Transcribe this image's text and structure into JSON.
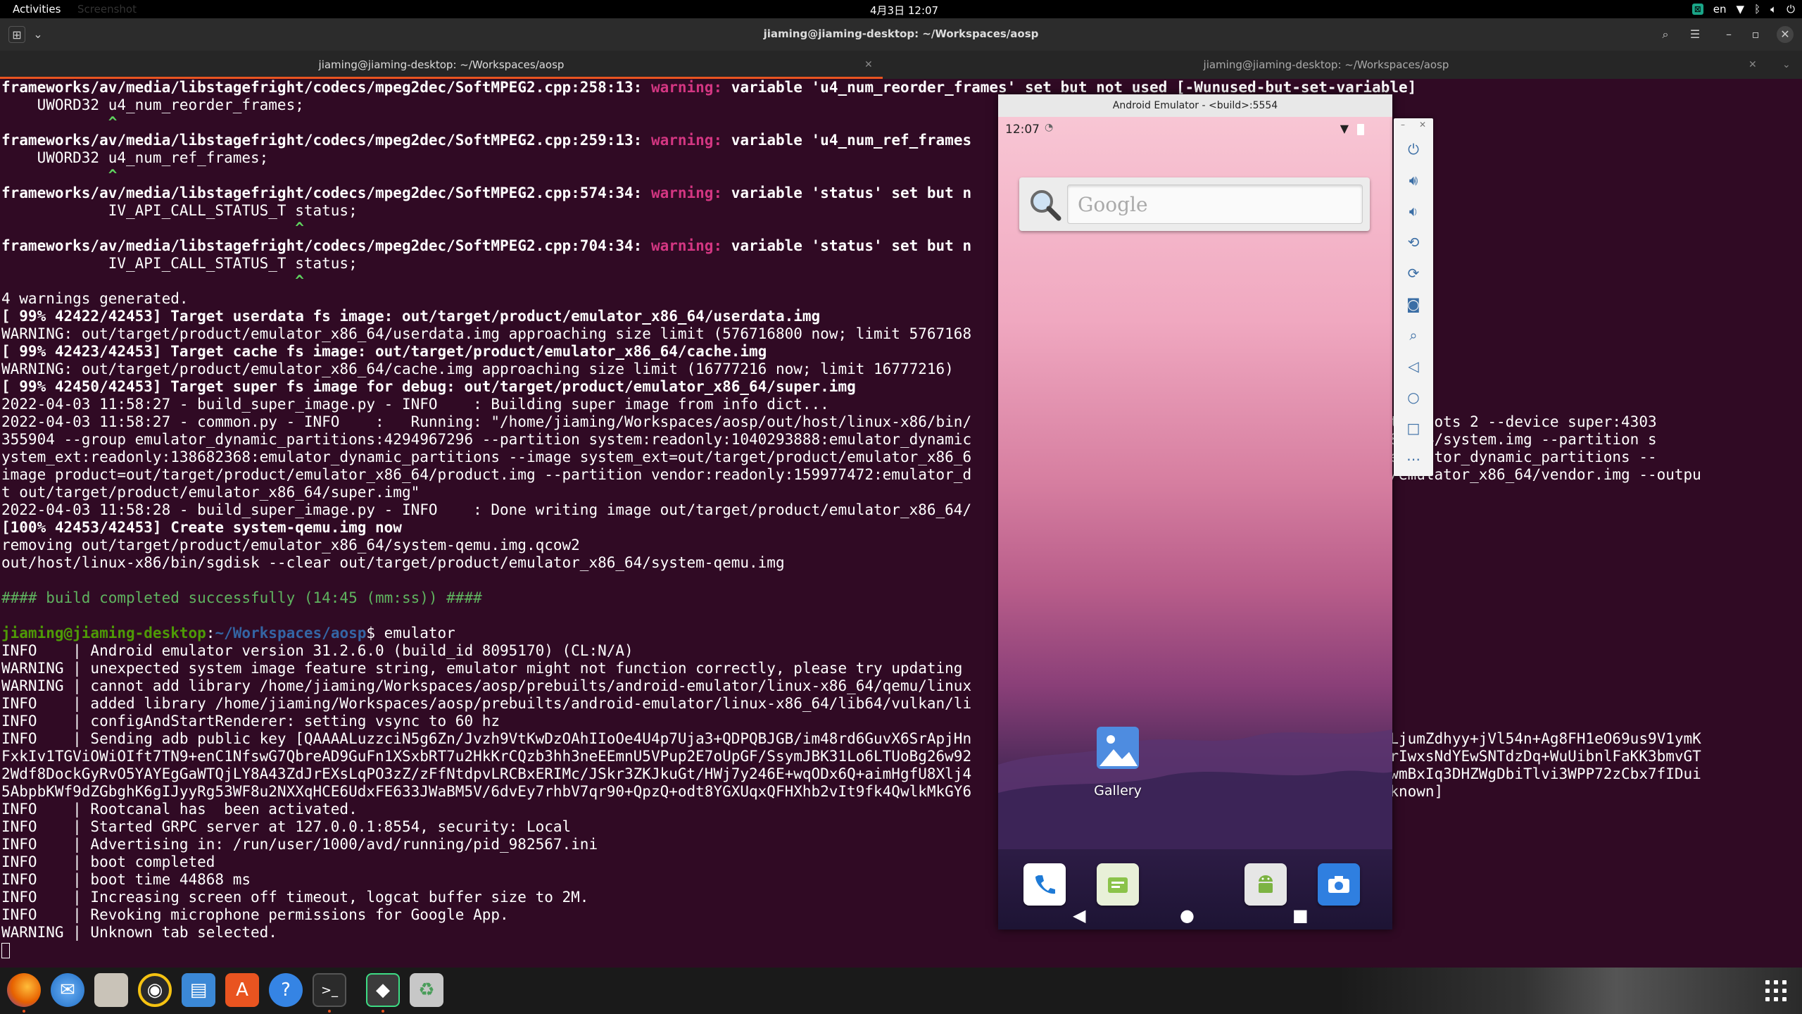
{
  "topbar": {
    "activities": "Activities",
    "ghost_label": "Screenshot",
    "clock": "4月3日  12:07",
    "lang": "en",
    "icons": [
      "app-indicator-icon",
      "wifi-icon",
      "bluetooth-icon",
      "volume-icon",
      "power-icon"
    ]
  },
  "terminal": {
    "window_title": "jiaming@jiaming-desktop: ~/Workspaces/aosp",
    "tabs": [
      {
        "label": "jiaming@jiaming-desktop: ~/Workspaces/aosp",
        "active": true
      },
      {
        "label": "jiaming@jiaming-desktop: ~/Workspaces/aosp",
        "active": false
      }
    ],
    "lines": [
      [
        {
          "t": "frameworks/av/media/libstagefright/codecs/mpeg2dec/SoftMPEG2.cpp:258:13: ",
          "c": "b"
        },
        {
          "t": "warning: ",
          "c": "warn"
        },
        {
          "t": "variable 'u4_num_reorder_frames' set but not used [-Wunused-but-set-variable]",
          "c": "b"
        }
      ],
      [
        {
          "t": "    UWORD32 u4_num_reorder_frames;",
          "c": ""
        }
      ],
      [
        {
          "t": "            ^",
          "c": "caret"
        }
      ],
      [
        {
          "t": "frameworks/av/media/libstagefright/codecs/mpeg2dec/SoftMPEG2.cpp:259:13: ",
          "c": "b"
        },
        {
          "t": "warning: ",
          "c": "warn"
        },
        {
          "t": "variable 'u4_num_ref_frames",
          "c": "b"
        }
      ],
      [
        {
          "t": "    UWORD32 u4_num_ref_frames;",
          "c": ""
        }
      ],
      [
        {
          "t": "            ^",
          "c": "caret"
        }
      ],
      [
        {
          "t": "frameworks/av/media/libstagefright/codecs/mpeg2dec/SoftMPEG2.cpp:574:34: ",
          "c": "b"
        },
        {
          "t": "warning: ",
          "c": "warn"
        },
        {
          "t": "variable 'status' set but n",
          "c": "b"
        }
      ],
      [
        {
          "t": "            IV_API_CALL_STATUS_T status;",
          "c": ""
        }
      ],
      [
        {
          "t": "                                 ^",
          "c": "caret"
        }
      ],
      [
        {
          "t": "frameworks/av/media/libstagefright/codecs/mpeg2dec/SoftMPEG2.cpp:704:34: ",
          "c": "b"
        },
        {
          "t": "warning: ",
          "c": "warn"
        },
        {
          "t": "variable 'status' set but n",
          "c": "b"
        }
      ],
      [
        {
          "t": "            IV_API_CALL_STATUS_T status;",
          "c": ""
        }
      ],
      [
        {
          "t": "                                 ^",
          "c": "caret"
        }
      ],
      [
        {
          "t": "4 warnings generated.",
          "c": ""
        }
      ],
      [
        {
          "t": "[ 99% 42422/42453] Target userdata fs image: out/target/product/emulator_x86_64/userdata.img",
          "c": "b"
        }
      ],
      [
        {
          "t": "WARNING: out/target/product/emulator_x86_64/userdata.img approaching size limit (576716800 now; limit 5767168",
          "c": ""
        }
      ],
      [
        {
          "t": "[ 99% 42423/42453] Target cache fs image: out/target/product/emulator_x86_64/cache.img",
          "c": "b"
        }
      ],
      [
        {
          "t": "WARNING: out/target/product/emulator_x86_64/cache.img approaching size limit (16777216 now; limit 16777216)",
          "c": ""
        }
      ],
      [
        {
          "t": "[ 99% 42450/42453] Target super fs image for debug: out/target/product/emulator_x86_64/super.img",
          "c": "b"
        }
      ],
      [
        {
          "t": "2022-04-03 11:58:27 - build_super_image.py - INFO    : Building super image from info dict...",
          "c": ""
        }
      ],
      [
        {
          "t": "2022-04-03 11:58:27 - common.py - INFO    :   Running: \"/home/jiaming/Workspaces/aosp/out/host/linux-x86/bin/                                       --metadata-slots 2 --device super:4303",
          "c": ""
        }
      ],
      [
        {
          "t": "355904 --group emulator_dynamic_partitions:4294967296 --partition system:readonly:1040293888:emulator_dynamic                                       ulator_x86_64/system.img --partition s",
          "c": ""
        }
      ],
      [
        {
          "t": "ystem_ext:readonly:138682368:emulator_dynamic_partitions --image system_ext=out/target/product/emulator_x86_6                                       4082944:emulator_dynamic_partitions --",
          "c": ""
        }
      ],
      [
        {
          "t": "image product=out/target/product/emulator_x86_64/product.img --partition vendor:readonly:159977472:emulator_d                                       /product/emulator_x86_64/vendor.img --outpu",
          "c": ""
        }
      ],
      [
        {
          "t": "t out/target/product/emulator_x86_64/super.img\"",
          "c": ""
        }
      ],
      [
        {
          "t": "2022-04-03 11:58:28 - build_super_image.py - INFO    : Done writing image out/target/product/emulator_x86_64/",
          "c": ""
        }
      ],
      [
        {
          "t": "[100% 42453/42453] Create system-qemu.img now",
          "c": "b"
        }
      ],
      [
        {
          "t": "removing out/target/product/emulator_x86_64/system-qemu.img.qcow2",
          "c": ""
        }
      ],
      [
        {
          "t": "out/host/linux-x86/bin/sgdisk --clear out/target/product/emulator_x86_64/system-qemu.img",
          "c": ""
        }
      ],
      [
        {
          "t": "",
          "c": ""
        }
      ],
      [
        {
          "t": "#### build completed successfully (14:45 (mm:ss)) ####",
          "c": "grn2"
        }
      ],
      [
        {
          "t": "",
          "c": ""
        }
      ],
      [
        {
          "t": "jiaming@jiaming-desktop",
          "c": "green b"
        },
        {
          "t": ":",
          "c": ""
        },
        {
          "t": "~/Workspaces/aosp",
          "c": "blue b"
        },
        {
          "t": "$ emulator",
          "c": ""
        }
      ],
      [
        {
          "t": "INFO    | Android emulator version 31.2.6.0 (build_id 8095170) (CL:N/A)",
          "c": ""
        }
      ],
      [
        {
          "t": "WARNING | unexpected system image feature string, emulator might not function correctly, please try updating",
          "c": ""
        }
      ],
      [
        {
          "t": "WARNING | cannot add library /home/jiaming/Workspaces/aosp/prebuilts/android-emulator/linux-x86_64/qemu/linux",
          "c": ""
        }
      ],
      [
        {
          "t": "INFO    | added library /home/jiaming/Workspaces/aosp/prebuilts/android-emulator/linux-x86_64/lib64/vulkan/li",
          "c": ""
        }
      ],
      [
        {
          "t": "INFO    | configAndStartRenderer: setting vsync to 60 hz",
          "c": ""
        }
      ],
      [
        {
          "t": "INFO    | Sending adb public key [QAAAALuzzciN5g6Zn/Jvzh9VtKwDzOAhIIoOe4U4p7Uja3+QDPQBJGB/im48rd6GuvX6SrApjHn                                       zHm91/BdLjumZdhyy+jVl54n+Ag8FH1eO69us9V1ymK",
          "c": ""
        }
      ],
      [
        {
          "t": "FxkIv1TGViOWiOIft7TN9+enC1NfswG7QbreAD9GuFn1XSxbRT7u2HkKrCQzb3hh3neEEmnU5VPup2E7oUpGF/SsymJBK31Lo6LTUoBg26w92                                       IgPP1i8CrIwxsNdYEwSNTdzDq+WuUibnlFaKK3bmvGT",
          "c": ""
        }
      ],
      [
        {
          "t": "2Wdf8DockGyRvO5YAYEgGaWTQjLY8A43ZdJrEXsLqPO3zZ/zFfNtdpvLRCBxERIMc/JSkr3ZKJkuGt/HWj7y246E+wqODx6Q+aimHgfU8Xlj4                                       57ZniHwuwmBxIq3DHZWgDbiTlvi3WPP72zCbx7fIDui",
          "c": ""
        }
      ],
      [
        {
          "t": "5AbpbKWf9dZGbghK6gIJyyRg53WF8u2NXXqHCE6UdxFE633JWaBM5V/6dvEy7rhbV7qr90+QpzQ+odt8YGXUqxQFHXhb2vIt9fk4QwlkMkGY6                                       aming@unknown]",
          "c": ""
        }
      ],
      [
        {
          "t": "INFO    | Rootcanal has  been activated.",
          "c": ""
        }
      ],
      [
        {
          "t": "INFO    | Started GRPC server at 127.0.0.1:8554, security: Local",
          "c": ""
        }
      ],
      [
        {
          "t": "INFO    | Advertising in: /run/user/1000/avd/running/pid_982567.ini",
          "c": ""
        }
      ],
      [
        {
          "t": "INFO    | boot completed",
          "c": ""
        }
      ],
      [
        {
          "t": "INFO    | boot time 44868 ms",
          "c": ""
        }
      ],
      [
        {
          "t": "INFO    | Increasing screen off timeout, logcat buffer size to 2M.",
          "c": ""
        }
      ],
      [
        {
          "t": "INFO    | Revoking microphone permissions for Google App.",
          "c": ""
        }
      ],
      [
        {
          "t": "WARNING | Unknown tab selected.",
          "c": ""
        }
      ]
    ]
  },
  "emulator": {
    "title": "Android Emulator - <build>:5554",
    "time": "12:07",
    "search_placeholder": "Google",
    "gallery_label": "Gallery",
    "toolbar": [
      "power-icon",
      "volume-up-icon",
      "volume-down-icon",
      "rotate-left-icon",
      "rotate-right-icon",
      "camera-icon",
      "zoom-icon",
      "back-icon",
      "home-icon",
      "overview-icon",
      "more-icon"
    ],
    "dock_apps": [
      "phone-icon",
      "messaging-icon",
      "android-icon",
      "camera-icon"
    ]
  },
  "dock": {
    "apps": [
      "firefox-icon",
      "thunderbird-icon",
      "files-icon",
      "rhythmbox-icon",
      "writer-icon",
      "software-icon",
      "help-icon",
      "terminal-icon",
      "android-studio-icon",
      "trash-icon"
    ]
  },
  "colors": {
    "terminal_bg": "#300a24",
    "warning": "#d33682",
    "prompt_green": "#4e9a06",
    "prompt_blue": "#3465a4",
    "accent": "#e95420"
  }
}
